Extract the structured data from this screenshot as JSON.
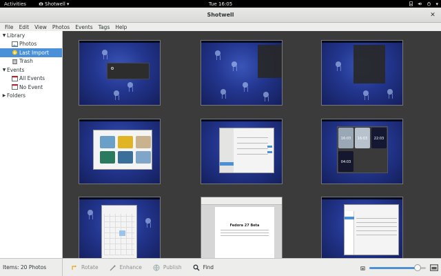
{
  "topbar": {
    "activities": "Activities",
    "app_name": "Shotwell",
    "clock": "Tue 16:05"
  },
  "window": {
    "title": "Shotwell",
    "close_glyph": "✕"
  },
  "menu": [
    "File",
    "Edit",
    "View",
    "Photos",
    "Events",
    "Tags",
    "Help"
  ],
  "sidebar": {
    "library": "Library",
    "photos": "Photos",
    "last_import": "Last Import",
    "trash": "Trash",
    "events": "Events",
    "all_events": "All Events",
    "no_event": "No Event",
    "folders": "Folders"
  },
  "status": {
    "items": "Items:  20 Photos"
  },
  "toolbar": {
    "rotate": "Rotate",
    "enhance": "Enhance",
    "publish": "Publish",
    "find": "Find",
    "zoom_fraction": 0.85
  },
  "thumbs": {
    "t4_note": "Fedora 27 Beta",
    "clock_a": "16:03",
    "clock_b": "16:03",
    "clock_c": "22:03",
    "clock_d": "04:03"
  },
  "colors": {
    "selection": "#4a90d9",
    "grid_bg": "#3b3b3b",
    "wallpaper": "#23368f"
  },
  "icons": {
    "app_menu": "camera-icon",
    "tray": [
      "network-icon",
      "volume-icon",
      "battery-icon",
      "power-icon"
    ],
    "rotate": "rotate-icon",
    "enhance": "wand-icon",
    "publish": "share-icon",
    "find": "search-icon",
    "zoom_out": "photo-small-icon",
    "zoom_in": "photo-large-icon"
  }
}
